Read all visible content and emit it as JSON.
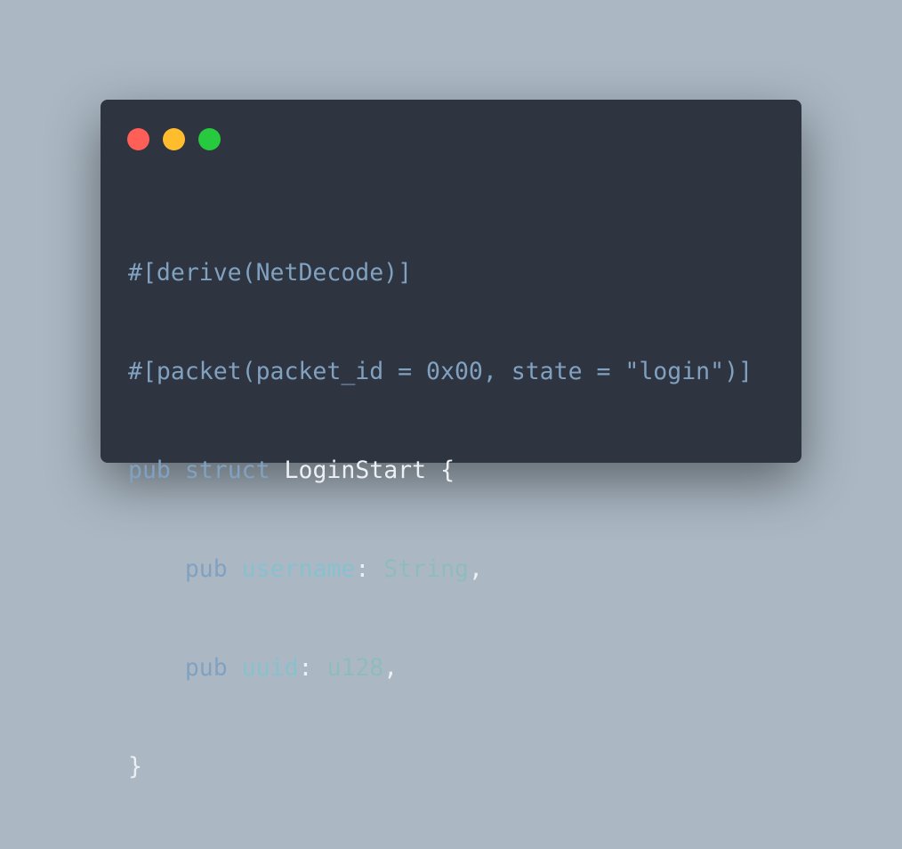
{
  "window": {
    "controls": {
      "close_color": "#ff5f56",
      "minimize_color": "#ffbd2e",
      "maximize_color": "#27c93f"
    },
    "colors": {
      "background": "#abb8c3",
      "editor": "#2e3440"
    }
  },
  "code": {
    "line1": "#[derive(NetDecode)]",
    "line2": "#[packet(packet_id = 0x00, state = \"login\")]",
    "line3": {
      "kw_pub": "pub",
      "kw_struct": "struct",
      "name": "LoginStart",
      "brace": "{"
    },
    "line4": {
      "indent": "    ",
      "kw_pub": "pub",
      "field": "username",
      "colon": ":",
      "type": "String",
      "comma": ","
    },
    "line5": {
      "indent": "    ",
      "kw_pub": "pub",
      "field": "uuid",
      "colon": ":",
      "type": "u128",
      "comma": ","
    },
    "line6": "}"
  }
}
